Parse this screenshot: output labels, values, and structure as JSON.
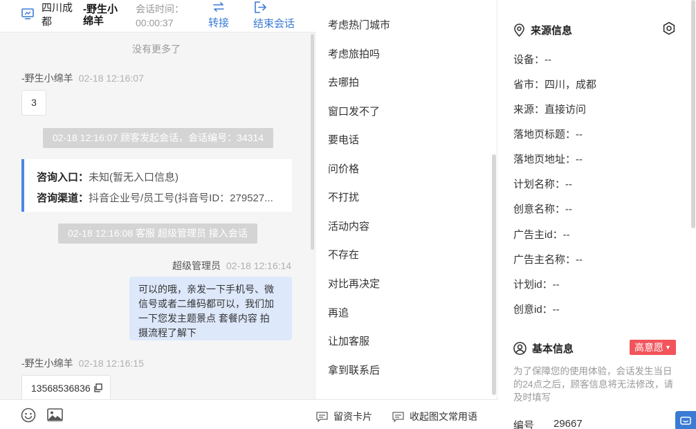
{
  "header": {
    "location": "四川成都",
    "username": "-野生小绵羊",
    "session_time_label": "会话时间：",
    "session_time": "00:00:37",
    "transfer_label": "转接",
    "end_label": "结束会话"
  },
  "chat": {
    "no_more": "没有更多了",
    "msg1": {
      "sender": "-野生小绵羊",
      "time": "02-18 12:16:07",
      "text": "3"
    },
    "sys1": "02-18 12:16:07 顾客发起会话，会话编号：34314",
    "consult": {
      "entry_label": "咨询入口：",
      "entry_value": "未知(暂无入口信息)",
      "channel_label": "咨询渠道：",
      "channel_value": "抖音企业号/员工号(抖音号ID：279527..."
    },
    "sys2": "02-18 12:16:08 客服 超级管理员 接入会话",
    "msg2": {
      "sender": "超级管理员",
      "time": "02-18 12:16:14",
      "lines": [
        "可以的哦，亲发一下手机号、微",
        "信号或者二维码都可以，我们加",
        "一下您发主题景点 套餐内容 拍",
        "摄流程了解下"
      ]
    },
    "msg3": {
      "sender": "-野生小绵羊",
      "time": "02-18 12:16:15",
      "text": "13568536836"
    }
  },
  "footer": {
    "card_label": "留资卡片",
    "collapse_label": "收起图文常用语"
  },
  "quick_replies": [
    "考虑热门城市",
    "考虑旅拍吗",
    "去哪拍",
    "窗口发不了",
    "要电话",
    "问价格",
    "不打扰",
    "活动内容",
    "不存在",
    "对比再决定",
    "再追",
    "让加客服",
    "拿到联系后"
  ],
  "source_info": {
    "title": "来源信息",
    "fields": [
      "设备：--",
      "省市：四川，成都",
      "来源：直接访问",
      "落地页标题：--",
      "落地页地址：--",
      "计划名称：--",
      "创意名称：--",
      "广告主id：--",
      "广告主名称：--",
      "计划id：--",
      "创意id：--"
    ]
  },
  "basic_info": {
    "title": "基本信息",
    "intent": "高意愿",
    "notice": "为了保障您的使用体验，会话发生当日的24点之后，顾客信息将无法修改，请及时填写",
    "id_label": "编号",
    "id_value": "29667"
  },
  "colors": {
    "accent": "#3a7bd5",
    "badge": "#f2545b",
    "my_bubble": "#dde8fb"
  }
}
